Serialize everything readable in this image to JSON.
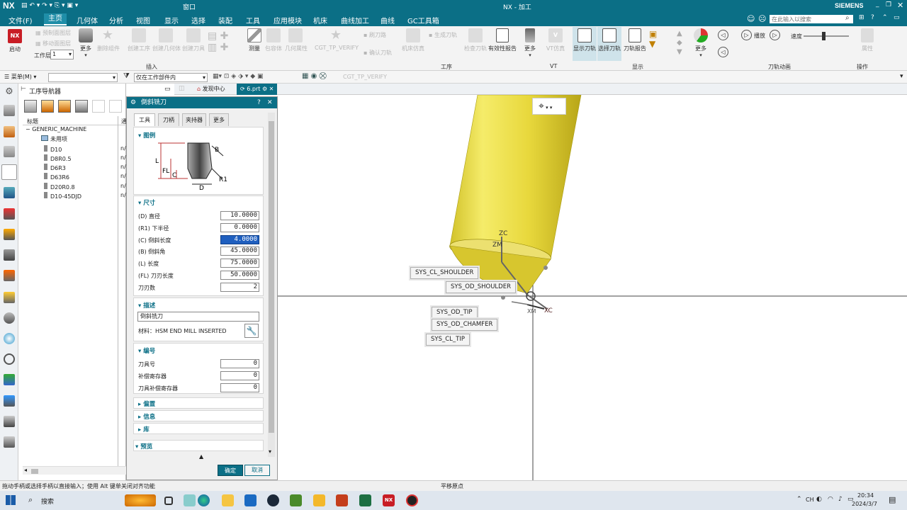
{
  "titlebar": {
    "logo": "NX",
    "window_menu": "窗口",
    "title": "NX - 加工",
    "brand": "SIEMENS"
  },
  "menubar": {
    "items": [
      "文件(F)",
      "主页",
      "几何体",
      "分析",
      "视图",
      "显示",
      "选择",
      "装配",
      "工具",
      "应用模块",
      "机床",
      "曲线加工",
      "曲线",
      "GC工具箱"
    ],
    "search_placeholder": "在此输入以搜索"
  },
  "ribbon": {
    "start_label": "启动",
    "workspace_label": "工作层",
    "workspace_value": "1",
    "buttons": [
      {
        "label": "预制面图层",
        "disabled": true
      },
      {
        "label": "移动面图层",
        "disabled": true
      },
      {
        "label": "更多",
        "disabled": false
      },
      {
        "label": "删除组件",
        "disabled": true
      },
      {
        "label": "创建工序",
        "disabled": true
      },
      {
        "label": "创建几何体",
        "disabled": true
      },
      {
        "label": "创建刀具",
        "disabled": true
      },
      {
        "label": "测量",
        "disabled": false
      },
      {
        "label": "包容体",
        "disabled": true
      },
      {
        "label": "几何属性",
        "disabled": true
      },
      {
        "label": "CGT_TP_VERIFY",
        "disabled": true
      },
      {
        "label": "刷刀路",
        "disabled": true
      },
      {
        "label": "确认刀轨",
        "disabled": true
      },
      {
        "label": "机床仿真",
        "disabled": true
      },
      {
        "label": "生成刀轨",
        "disabled": true
      },
      {
        "label": "检查刀轨",
        "disabled": true
      },
      {
        "label": "有效性报告",
        "disabled": false
      },
      {
        "label": "更多",
        "disabled": false
      },
      {
        "label": "VT仿真",
        "disabled": true
      },
      {
        "label": "显示刀轨",
        "disabled": false
      },
      {
        "label": "选择刀轨",
        "disabled": false
      },
      {
        "label": "刀轨报告",
        "disabled": false
      },
      {
        "label": "更多",
        "disabled": false
      },
      {
        "label": "播放",
        "disabled": false
      },
      {
        "label": "速度",
        "disabled": false
      },
      {
        "label": "属性",
        "disabled": true
      }
    ],
    "group_labels": [
      "插入",
      "工序",
      "VT",
      "显示",
      "刀轨动画",
      "操作"
    ]
  },
  "toolbar2": {
    "menu_label": "菜单(M)",
    "filter_value": "仅在工作部件内",
    "verify_label": "CGT_TP_VERIFY"
  },
  "navigator": {
    "title": "工序导航器",
    "col_name": "标题",
    "col_second": "通",
    "root": "GENERIC_MACHINE",
    "items": [
      {
        "name": "未用项",
        "value": ""
      },
      {
        "name": "D10",
        "value": "n/"
      },
      {
        "name": "D8R0.5",
        "value": "n/"
      },
      {
        "name": "D6R3",
        "value": "n/"
      },
      {
        "name": "D63R6",
        "value": "n/"
      },
      {
        "name": "D20R0.8",
        "value": "n/"
      },
      {
        "name": "D10-45DJD",
        "value": "n/"
      }
    ]
  },
  "doc_tabs": [
    {
      "label": "发现中心"
    },
    {
      "label": "6.prt"
    }
  ],
  "dialog": {
    "title": "倒斜铣刀",
    "tabs": [
      "工具",
      "刀柄",
      "夹持器",
      "更多"
    ],
    "legend_header": "图例",
    "legend_labels": {
      "L": "L",
      "FL": "FL",
      "C": "C",
      "B": "B",
      "R1": "R1",
      "D": "D"
    },
    "dims_header": "尺寸",
    "dims": [
      {
        "label": "(D) 直径",
        "value": "10.0000"
      },
      {
        "label": "(R1) 下半径",
        "value": "0.0000"
      },
      {
        "label": "(C) 倒斜长度",
        "value": "4.0000"
      },
      {
        "label": "(B) 倒斜角",
        "value": "45.0000"
      },
      {
        "label": "(L) 长度",
        "value": "75.0000"
      },
      {
        "label": "(FL) 刀刃长度",
        "value": "50.0000"
      },
      {
        "label": "刀刃数",
        "value": "2"
      }
    ],
    "desc_header": "描述",
    "desc_value": "倒斜铣刀",
    "material": "材料：HSM END MILL INSERTED",
    "num_header": "编号",
    "nums": [
      {
        "label": "刀具号",
        "value": "0"
      },
      {
        "label": "补偿寄存器",
        "value": "0"
      },
      {
        "label": "刀具补偿寄存器",
        "value": "0"
      }
    ],
    "collapsed": [
      "偏置",
      "信息",
      "库"
    ],
    "preview_header": "预览",
    "ok": "确定",
    "cancel": "取消"
  },
  "viewport": {
    "axis_labels": [
      "ZC",
      "ZM",
      "XC",
      "XM"
    ],
    "labels": [
      "SYS_CL_SHOULDER",
      "SYS_OD_SHOULDER",
      "SYS_OD_TIP",
      "SYS_OD_CHAMFER",
      "SYS_CL_TIP"
    ]
  },
  "status": {
    "left": "拖动手柄或选择手柄以直接输入；使用 Alt 键单关闭对齐功能",
    "center": "平移原点"
  },
  "taskbar": {
    "search": "搜索",
    "time": "20:34",
    "date": "2024/3/7",
    "lang": "CH"
  }
}
